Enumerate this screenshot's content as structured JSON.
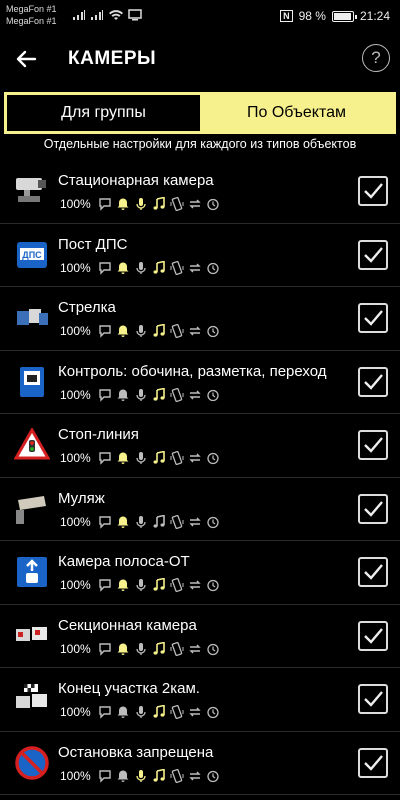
{
  "status_bar": {
    "carrier_1": "MegaFon #1",
    "carrier_2": "MegaFon #1",
    "nfc": "N",
    "battery_text": "98 %",
    "battery_level": 0.98,
    "time": "21:24"
  },
  "app_bar": {
    "back_icon": "arrow-left",
    "title": "КАМЕРЫ",
    "help_label": "?"
  },
  "tabs": [
    {
      "label": "Для группы",
      "active": false
    },
    {
      "label": "По Объектам",
      "active": true
    }
  ],
  "subtitle": "Отдельные настройки для каждого из типов объектов",
  "colors": {
    "accent": "#f6f18c",
    "active_icon": "#f6f18c",
    "inactive_icon": "#bdbdbd",
    "background": "#000000"
  },
  "objects": [
    {
      "name": "Стационарная камера",
      "volume": "100%",
      "icon": "stationary-camera",
      "checked": true
    },
    {
      "name": "Пост ДПС",
      "volume": "100%",
      "icon": "dps-post",
      "icon_text": "ДПС",
      "checked": true
    },
    {
      "name": "Стрелка",
      "volume": "100%",
      "icon": "strelka",
      "checked": true
    },
    {
      "name": "Контроль: обочина, разметка, переход",
      "volume": "100%",
      "icon": "control-sign",
      "checked": true
    },
    {
      "name": "Стоп-линия",
      "volume": "100%",
      "icon": "stop-line",
      "checked": true
    },
    {
      "name": "Муляж",
      "volume": "100%",
      "icon": "dummy-camera",
      "checked": true
    },
    {
      "name": "Камера полоса-ОТ",
      "volume": "100%",
      "icon": "bus-lane",
      "checked": true
    },
    {
      "name": "Секционная камера",
      "volume": "100%",
      "icon": "section-camera",
      "checked": true
    },
    {
      "name": "Конец участка 2кам.",
      "volume": "100%",
      "icon": "section-end",
      "checked": true
    },
    {
      "name": "Остановка запрещена",
      "volume": "100%",
      "icon": "no-stopping",
      "checked": true
    }
  ],
  "alert_icons": [
    "message-icon",
    "bell-icon",
    "mic-icon",
    "music-icon",
    "phone-vibrate-icon",
    "repeat-icon",
    "timer-icon"
  ],
  "alert_states": [
    [
      false,
      true,
      true,
      true,
      false,
      false,
      false
    ],
    [
      false,
      true,
      false,
      true,
      false,
      false,
      false
    ],
    [
      false,
      true,
      false,
      true,
      false,
      false,
      false
    ],
    [
      false,
      false,
      false,
      true,
      false,
      false,
      false
    ],
    [
      false,
      true,
      false,
      true,
      false,
      false,
      false
    ],
    [
      false,
      true,
      false,
      false,
      false,
      false,
      false
    ],
    [
      false,
      true,
      false,
      true,
      false,
      false,
      false
    ],
    [
      false,
      true,
      false,
      true,
      false,
      false,
      false
    ],
    [
      false,
      false,
      false,
      true,
      false,
      false,
      false
    ],
    [
      false,
      false,
      true,
      true,
      false,
      false,
      false
    ]
  ]
}
